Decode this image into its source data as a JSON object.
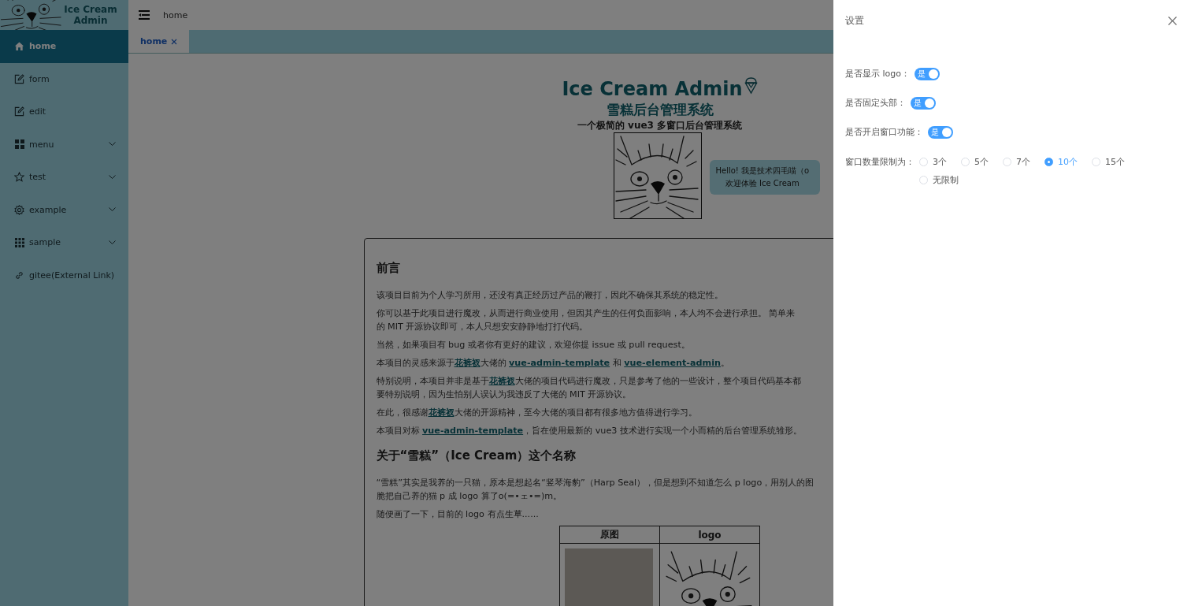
{
  "sidebar": {
    "logo_text": "Ice Cream Admin",
    "items": [
      {
        "label": "home",
        "selected": true
      },
      {
        "label": "form",
        "selected": false
      },
      {
        "label": "edit",
        "selected": false
      },
      {
        "label": "menu",
        "selected": false,
        "expanded": false
      },
      {
        "label": "test",
        "selected": false,
        "expanded": false
      },
      {
        "label": "example",
        "selected": false,
        "expanded": false
      },
      {
        "label": "sample",
        "selected": false,
        "expanded": false
      },
      {
        "label": "gitee(External Link)",
        "selected": false
      }
    ]
  },
  "header": {
    "breadcrumb": "home"
  },
  "tabs": [
    {
      "label": "home",
      "selected": true
    }
  ],
  "hero": {
    "title": "Ice Cream Admin",
    "subtitle": "雪糕后台管理系统",
    "tagline": "一个极简的 vue3 多窗口后台管理系统",
    "bubble": [
      "Hello! 我是技术四毛喵（o",
      "欢迎体验 Ice Cream"
    ]
  },
  "article": {
    "blocks": [
      {
        "kind": "heading",
        "text": "前言"
      },
      {
        "kind": "paragraph",
        "lines": [
          [
            "该项目目前为个人学习所用，还没有真正经历过产品的鞭打，因此不确保其系统的稳定性。"
          ]
        ]
      },
      {
        "kind": "paragraph",
        "lines": [
          [
            "你可以基于此项目进行魔改，从而进行商业使用，但因其产生的任何负面影响，本人均不会进行承担。 简单来"
          ],
          [
            "的 MIT 开源协议即可，本人只想安安静静地打打代码。"
          ]
        ]
      },
      {
        "kind": "paragraph",
        "lines": [
          [
            "当然，如果项目有 bug 或者你有更好的建议，欢迎你提 issue 或 pull request。"
          ]
        ]
      },
      {
        "kind": "paragraph",
        "lines": [
          [
            "本项目的灵感来源于",
            {
              "link": "花裤衩"
            },
            "大佬的 ",
            {
              "link": "vue-admin-template"
            },
            " 和 ",
            {
              "link": "vue-element-admin"
            },
            "。"
          ]
        ]
      },
      {
        "kind": "paragraph",
        "lines": [
          [
            "特别说明，本项目并非是基于",
            {
              "link": "花裤衩"
            },
            "大佬的项目代码进行魔改，只是参考了他的一些设计，整个项目代码基本都"
          ],
          [
            "要特别说明，因为生怕别人误认为我违反了大佬的 MIT 开源协议。"
          ]
        ]
      },
      {
        "kind": "paragraph",
        "lines": [
          [
            "在此，很感谢",
            {
              "link": "花裤衩"
            },
            "大佬的开源精神，至今大佬的项目都有很多地方值得进行学习。"
          ]
        ]
      },
      {
        "kind": "paragraph",
        "lines": [
          [
            "本项目对标 ",
            {
              "link": "vue-admin-template"
            },
            "，旨在使用最新的 vue3 技术进行实现一个小而精的后台管理系统雏形。"
          ]
        ]
      },
      {
        "kind": "heading",
        "text": "关于“雪糕”（Ice Cream）这个名称"
      },
      {
        "kind": "paragraph",
        "lines": [
          [
            "“雪糕”其实是我养的一只猫，原本是想起名“竖琴海豹”（Harp Seal），但是想到不知道怎么 p logo，用别人的图"
          ],
          [
            "脆把自己养的猫 p 成 logo 算了o(=•ェ•=)m。"
          ]
        ]
      },
      {
        "kind": "paragraph",
        "lines": [
          [
            "随便画了一下，目前的 logo 有点生草......"
          ]
        ]
      },
      {
        "kind": "table",
        "columns": [
          "原图",
          "logo"
        ]
      }
    ]
  },
  "settings_drawer": {
    "title": "设置",
    "switches": [
      {
        "label": "是否显示 logo：",
        "on_text": "是",
        "on": true
      },
      {
        "label": "是否固定头部：",
        "on_text": "是",
        "on": true
      },
      {
        "label": "是否开启窗口功能：",
        "on_text": "是",
        "on": true
      }
    ],
    "window_limit": {
      "label": "窗口数量限制为：",
      "options": [
        {
          "label": "3个",
          "selected": false
        },
        {
          "label": "5个",
          "selected": false
        },
        {
          "label": "7个",
          "selected": false
        },
        {
          "label": "10个",
          "selected": true
        },
        {
          "label": "15个",
          "selected": false
        },
        {
          "label": "无限制",
          "selected": false
        }
      ]
    }
  }
}
